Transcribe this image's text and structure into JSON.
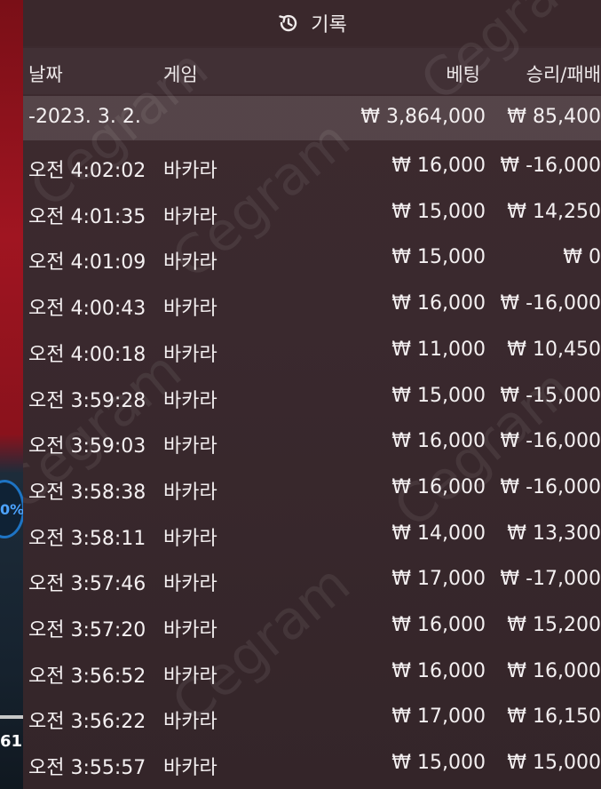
{
  "header": {
    "title": "기록",
    "icon": "history-icon"
  },
  "columns": {
    "date": "날짜",
    "game": "게임",
    "bet": "베팅",
    "win_loss": "승리/패배"
  },
  "summary": {
    "date": "-2023. 3. 2.",
    "bet": "₩ 3,864,000",
    "win_loss": "₩ 85,400"
  },
  "rows": [
    {
      "time": "오전 4:02:02",
      "game": "바카라",
      "bet": "₩ 16,000",
      "win_loss": "₩ -16,000"
    },
    {
      "time": "오전 4:01:35",
      "game": "바카라",
      "bet": "₩ 15,000",
      "win_loss": "₩ 14,250"
    },
    {
      "time": "오전 4:01:09",
      "game": "바카라",
      "bet": "₩ 15,000",
      "win_loss": "₩ 0"
    },
    {
      "time": "오전 4:00:43",
      "game": "바카라",
      "bet": "₩ 16,000",
      "win_loss": "₩ -16,000"
    },
    {
      "time": "오전 4:00:18",
      "game": "바카라",
      "bet": "₩ 11,000",
      "win_loss": "₩ 10,450"
    },
    {
      "time": "오전 3:59:28",
      "game": "바카라",
      "bet": "₩ 15,000",
      "win_loss": "₩ -15,000"
    },
    {
      "time": "오전 3:59:03",
      "game": "바카라",
      "bet": "₩ 16,000",
      "win_loss": "₩ -16,000"
    },
    {
      "time": "오전 3:58:38",
      "game": "바카라",
      "bet": "₩ 16,000",
      "win_loss": "₩ -16,000"
    },
    {
      "time": "오전 3:58:11",
      "game": "바카라",
      "bet": "₩ 14,000",
      "win_loss": "₩ 13,300"
    },
    {
      "time": "오전 3:57:46",
      "game": "바카라",
      "bet": "₩ 17,000",
      "win_loss": "₩ -17,000"
    },
    {
      "time": "오전 3:57:20",
      "game": "바카라",
      "bet": "₩ 16,000",
      "win_loss": "₩ 15,200"
    },
    {
      "time": "오전 3:56:52",
      "game": "바카라",
      "bet": "₩ 16,000",
      "win_loss": "₩ 16,000"
    },
    {
      "time": "오전 3:56:22",
      "game": "바카라",
      "bet": "₩ 17,000",
      "win_loss": "₩ 16,150"
    },
    {
      "time": "오전 3:55:57",
      "game": "바카라",
      "bet": "₩ 15,000",
      "win_loss": "₩ 15,000"
    }
  ],
  "background_app": {
    "percent": "0%",
    "number": "61"
  },
  "watermark": "Cegram",
  "colors": {
    "panel": "#3a292e",
    "header": "#3a282c",
    "text": "#f4f0f1",
    "accent_red": "#a01521"
  }
}
